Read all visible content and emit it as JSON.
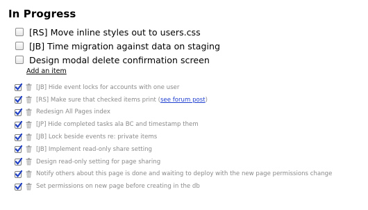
{
  "section": {
    "title": "In Progress"
  },
  "open_items": [
    {
      "label": "[RS] Move inline styles out to users.css"
    },
    {
      "label": "[JB] Time migration against data on staging"
    },
    {
      "label": "Design modal delete confirmation screen"
    }
  ],
  "add_item_label": "Add an item",
  "done_items": [
    {
      "label": "[JB] Hide event locks for accounts with one user"
    },
    {
      "label": "[RS] Make sure that checked items print (",
      "link": "see forum post",
      "suffix": ")"
    },
    {
      "label": "Redesign All Pages index"
    },
    {
      "label": "[JP] Hide completed tasks ala BC and timestamp them"
    },
    {
      "label": "[JB] Lock beside events re: private items"
    },
    {
      "label": "[JB] Implement read-only share setting"
    },
    {
      "label": "Design read-only setting for page sharing"
    },
    {
      "label": "Notify others about this page is done and waiting to deploy with the new page permissions change"
    },
    {
      "label": "Set permissions on new page before creating in the db"
    }
  ],
  "colors": {
    "checkmark": "#1f3fc4",
    "done_text": "#8a8a8a",
    "link": "#1f3fd0"
  }
}
